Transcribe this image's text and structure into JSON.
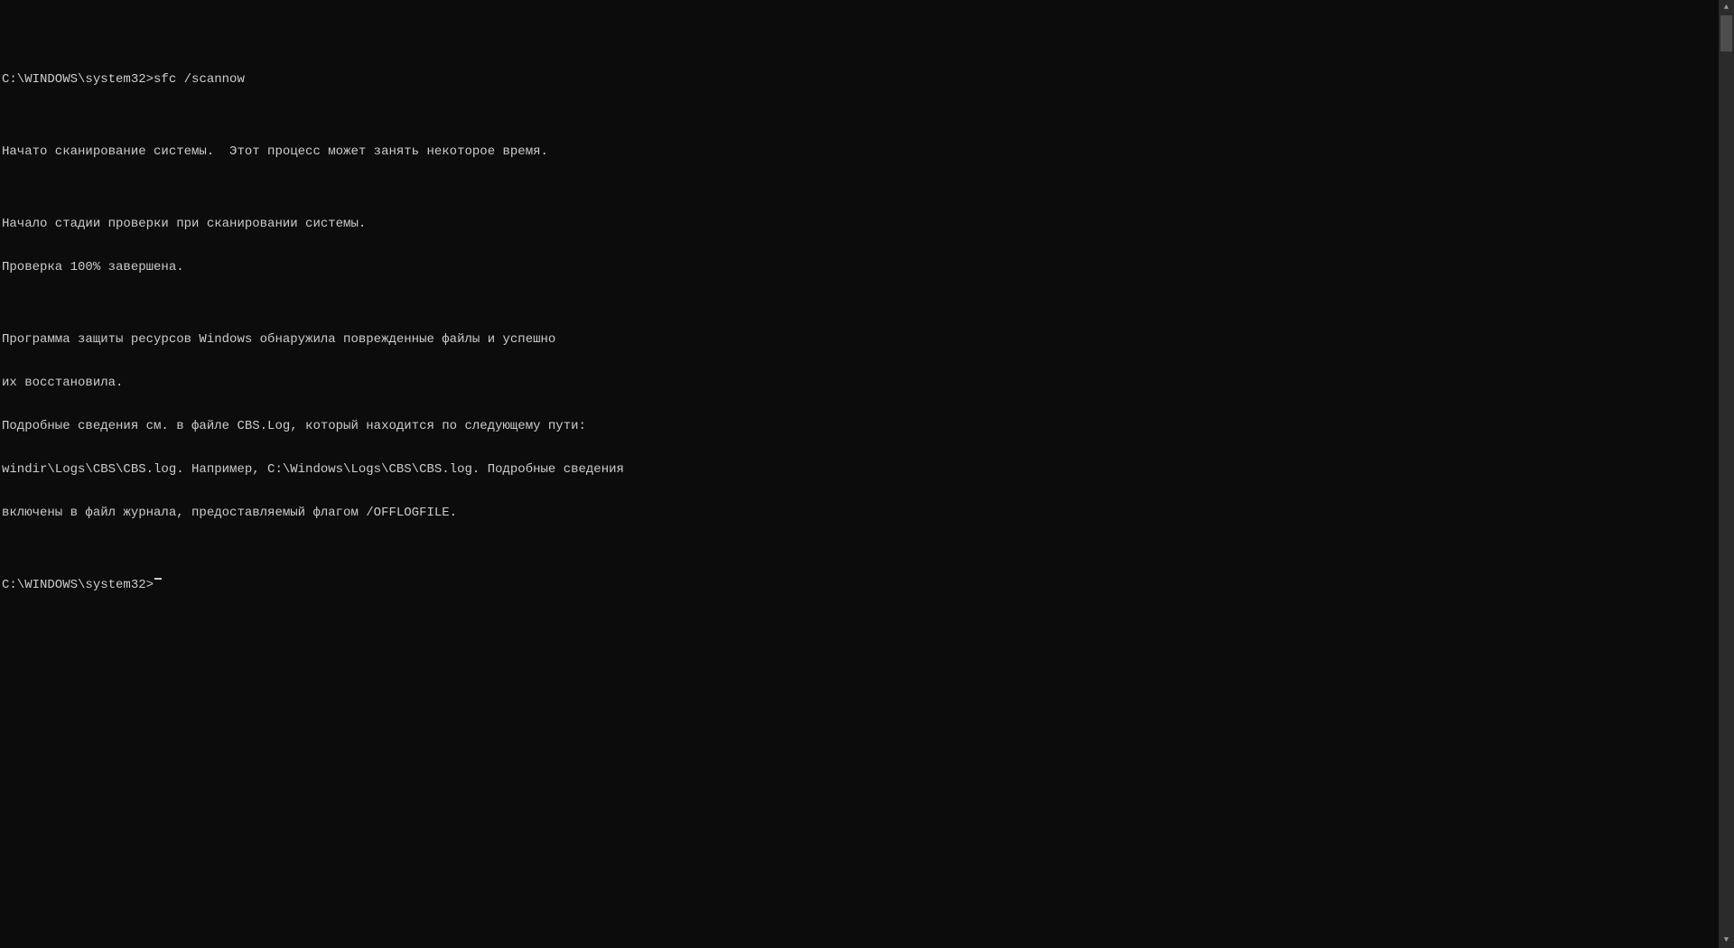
{
  "console": {
    "prompt_path": "C:\\WINDOWS\\system32>",
    "command": "sfc /scannow",
    "lines": [
      "",
      "Начато сканирование системы.  Этот процесс может занять некоторое время.",
      "",
      "Начало стадии проверки при сканировании системы.",
      "Проверка 100% завершена.",
      "",
      "Программа защиты ресурсов Windows обнаружила поврежденные файлы и успешно",
      "их восстановила.",
      "Подробные сведения см. в файле CBS.Log, который находится по следующему пути:",
      "windir\\Logs\\CBS\\CBS.log. Например, C:\\Windows\\Logs\\CBS\\CBS.log. Подробные сведения",
      "включены в файл журнала, предоставляемый флагом /OFFLOGFILE.",
      ""
    ],
    "final_prompt": "C:\\WINDOWS\\system32>"
  },
  "scrollbar": {
    "up_glyph": "▲",
    "down_glyph": "▼"
  }
}
